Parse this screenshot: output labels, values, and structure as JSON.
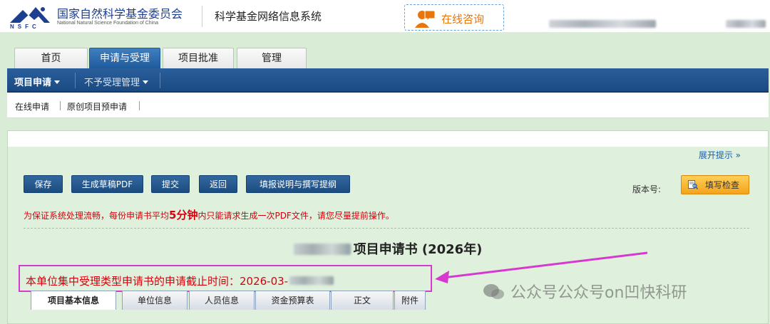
{
  "header": {
    "org_name_cn": "国家自然科学基金委员会",
    "org_name_en": "National Natural Science Foundation of China",
    "org_abbr": "NSFC",
    "system_title": "科学基金网络信息系统",
    "consult_label": "在线咨询"
  },
  "main_tabs": [
    {
      "label": "首页",
      "active": false
    },
    {
      "label": "申请与受理",
      "active": true
    },
    {
      "label": "项目批准",
      "active": false
    },
    {
      "label": "管理",
      "active": false
    }
  ],
  "subnav": {
    "items": [
      {
        "label": "项目申请",
        "active": true
      },
      {
        "label": "不予受理管理",
        "active": false
      }
    ]
  },
  "breadcrumbs": [
    "在线申请",
    "原创项目预申请"
  ],
  "panel": {
    "expand_label": "展开提示",
    "buttons": [
      "保存",
      "生成草稿PDF",
      "提交",
      "返回",
      "填报说明与撰写提纲"
    ],
    "version_label": "版本号:",
    "check_label": "填写检查",
    "notice_prefix": "为保证系统处理流畅，每份申请书平均",
    "notice_emph": "5分钟",
    "notice_suffix": "内只能请求生成一次PDF文件，请您尽量提前操作。",
    "doc_title": "项目申请书 (2026年)",
    "deadline": "本单位集中受理类型申请书的申请截止时间：2026-03-"
  },
  "bottom_tabs": [
    {
      "label": "项目基本信息",
      "active": true
    },
    {
      "label": "单位信息",
      "active": false
    },
    {
      "label": "人员信息",
      "active": false
    },
    {
      "label": "资金预算表",
      "active": false
    },
    {
      "label": "正文",
      "active": false
    },
    {
      "label": "附件",
      "active": false
    }
  ],
  "watermark": "公众号公众号on凹快科研",
  "colors": {
    "accent_blue": "#1a4a82",
    "notice_red": "#d9000d",
    "highlight_magenta": "#d739d0",
    "consult_orange": "#e8750e",
    "page_green": "#d8ecd6"
  }
}
